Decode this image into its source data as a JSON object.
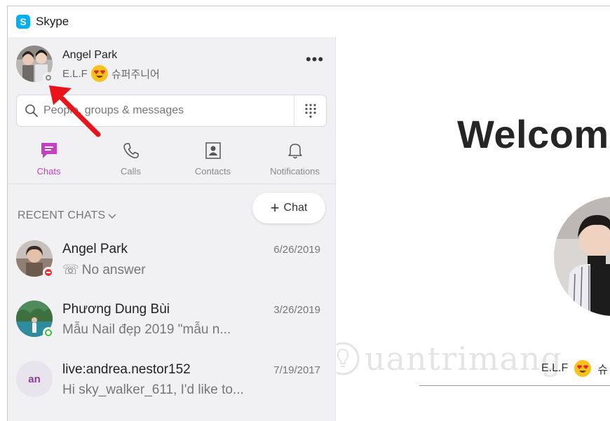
{
  "window": {
    "title": "Skype"
  },
  "profile": {
    "name": "Angel Park",
    "mood_prefix": "E.L.F",
    "mood_suffix": "슈퍼주니어",
    "status": "offline",
    "more_label": "•••"
  },
  "search": {
    "placeholder": "People, groups & messages"
  },
  "tabs": [
    {
      "label": "Chats",
      "icon": "chat-icon",
      "active": true
    },
    {
      "label": "Calls",
      "icon": "phone-icon",
      "active": false
    },
    {
      "label": "Contacts",
      "icon": "contacts-icon",
      "active": false
    },
    {
      "label": "Notifications",
      "icon": "bell-icon",
      "active": false
    }
  ],
  "recent": {
    "header": "RECENT CHATS",
    "new_chat_label": "Chat",
    "new_chat_icon": "+"
  },
  "chats": [
    {
      "name": "Angel Park",
      "date": "6/26/2019",
      "preview": "No answer",
      "preview_icon": "☏",
      "status": "busy"
    },
    {
      "name": "Phương Dung Bùi",
      "date": "3/26/2019",
      "preview": "Mẫu Nail đẹp 2019  \"mẫu n...",
      "status": "online"
    },
    {
      "name": "live:andrea.nestor152",
      "date": "7/19/2017",
      "preview": "Hi sky_walker_611, I'd like to...",
      "initials": "an"
    }
  ],
  "main": {
    "welcome": "Welcom",
    "mood_prefix": "E.L.F",
    "mood_suffix": "슈",
    "watermark": "uantrimang"
  },
  "colors": {
    "accent": "#c43fc6",
    "skype_blue": "#00aff0",
    "online": "#3cbf3c",
    "busy": "#e0373a",
    "arrow": "#e8141a"
  }
}
